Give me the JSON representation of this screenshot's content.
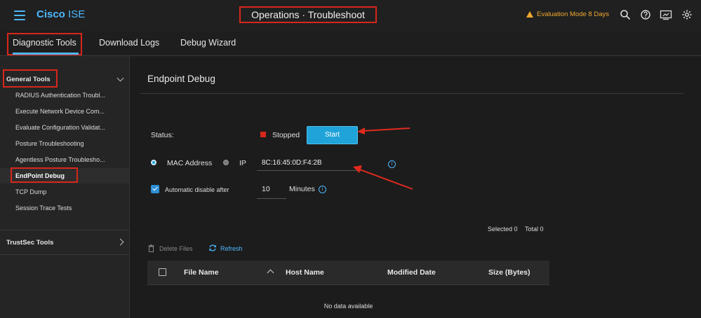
{
  "header": {
    "brand_bold": "Cisco",
    "brand_rest": " ISE",
    "page_title": "Operations · Troubleshoot",
    "evaluation": "Evaluation Mode 8 Days"
  },
  "tabs": [
    {
      "label": "Diagnostic Tools",
      "active": true
    },
    {
      "label": "Download Logs"
    },
    {
      "label": "Debug Wizard"
    }
  ],
  "sidebar": {
    "general_label": "General Tools",
    "items": [
      "RADIUS Authentication Troubl...",
      "Execute Network Device Com...",
      "Evaluate Configuration Validat...",
      "Posture Troubleshooting",
      "Agentless Posture Troublesho...",
      "EndPoint Debug",
      "TCP Dump",
      "Session Trace Tests"
    ],
    "active_item": "EndPoint Debug",
    "trustsec_label": "TrustSec Tools"
  },
  "main": {
    "title": "Endpoint Debug",
    "status_label": "Status:",
    "status_value": "Stopped",
    "start_button": "Start",
    "mac_label": "MAC Address",
    "ip_label": "IP",
    "mac_value": "8C:16:45:0D:F4:2B",
    "auto_disable_label": "Automatic disable after",
    "minutes_value": "10",
    "minutes_label": "Minutes",
    "selected": "Selected 0",
    "total": "Total 0",
    "delete_files": "Delete Files",
    "refresh": "Refresh",
    "table": {
      "headers": [
        "File Name",
        "Host Name",
        "Modified Date",
        "Size (Bytes)"
      ],
      "empty": "No data available"
    }
  },
  "colors": {
    "accent": "#4db8ff",
    "highlight": "#d9261c",
    "start": "#1fa3d8",
    "warning": "#f0a830"
  }
}
